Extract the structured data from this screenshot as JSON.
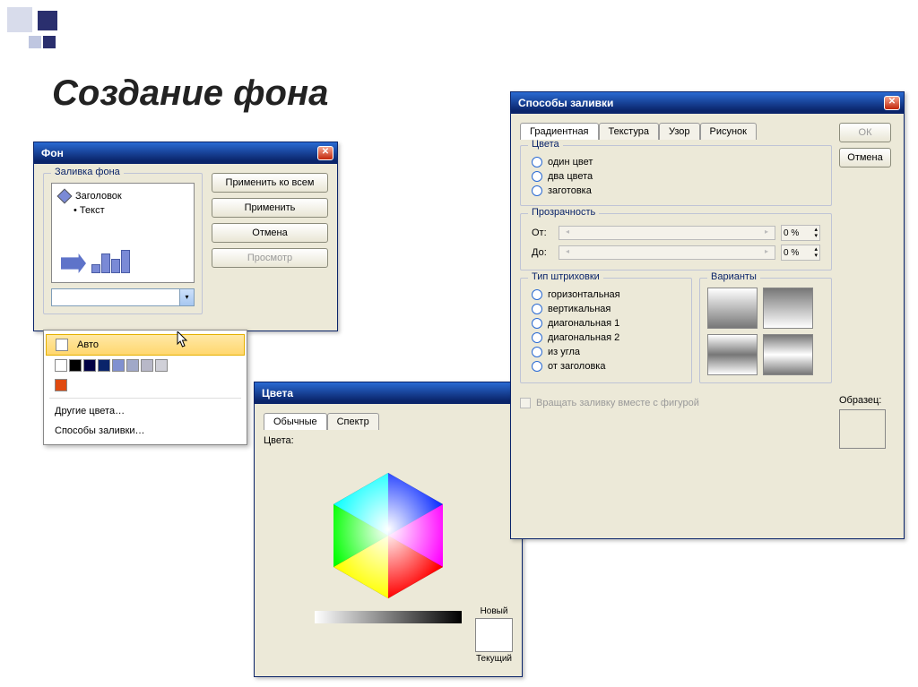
{
  "slide": {
    "title": "Создание фона"
  },
  "win_bg": {
    "title": "Фон",
    "group_label": "Заливка фона",
    "thumb_heading": "Заголовок",
    "thumb_bullet": "Текст",
    "buttons": {
      "apply_all": "Применить ко всем",
      "apply": "Применить",
      "cancel": "Отмена",
      "preview": "Просмотр"
    }
  },
  "color_popup": {
    "auto": "Авто",
    "row1_colors": [
      "#ffffff",
      "#000000",
      "#020244",
      "#0a246a",
      "#8090d0",
      "#a0a8c8",
      "#b8b8c8",
      "#d0d0d8"
    ],
    "recent_color": "#e04a10",
    "more": "Другие цвета…",
    "fill_effects": "Способы заливки…"
  },
  "win_colors": {
    "title": "Цвета",
    "tabs": [
      "Обычные",
      "Спектр"
    ],
    "label": "Цвета:",
    "new": "Новый",
    "current": "Текущий"
  },
  "win_fill": {
    "title": "Способы заливки",
    "tabs": [
      "Градиентная",
      "Текстура",
      "Узор",
      "Рисунок"
    ],
    "ok": "ОК",
    "cancel": "Отмена",
    "group_colors": "Цвета",
    "colors_opts": [
      "один цвет",
      "два цвета",
      "заготовка"
    ],
    "group_transp": "Прозрачность",
    "from": "От:",
    "to": "До:",
    "pct": "0 %",
    "group_shading": "Тип штриховки",
    "shading_opts": [
      "горизонтальная",
      "вертикальная",
      "диагональная 1",
      "диагональная 2",
      "из угла",
      "от заголовка"
    ],
    "group_variants": "Варианты",
    "sample": "Образец:",
    "rotate": "Вращать заливку вместе с фигурой"
  }
}
